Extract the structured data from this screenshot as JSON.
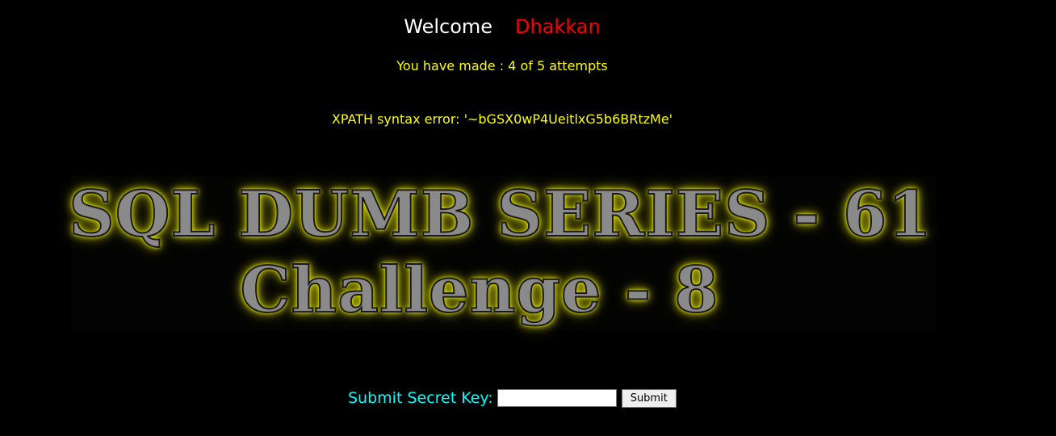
{
  "header": {
    "welcome_label": "Welcome",
    "username": "Dhakkan"
  },
  "status": {
    "attempts_text": "You have made : 4 of 5 attempts",
    "error_text": "XPATH syntax error: '~bGSX0wP4UeitlxG5b6BRtzMe'"
  },
  "banner": {
    "line1": "SQL DUMB SERIES - 61",
    "line2": "Challenge - 8"
  },
  "form": {
    "label": "Submit Secret Key:",
    "input_value": "",
    "submit_label": "Submit"
  },
  "colors": {
    "background": "#000000",
    "welcome": "#ffffff",
    "username": "#ff0000",
    "status": "#ffff00",
    "form_label": "#00ffff",
    "banner_glow": "#ffff00"
  }
}
